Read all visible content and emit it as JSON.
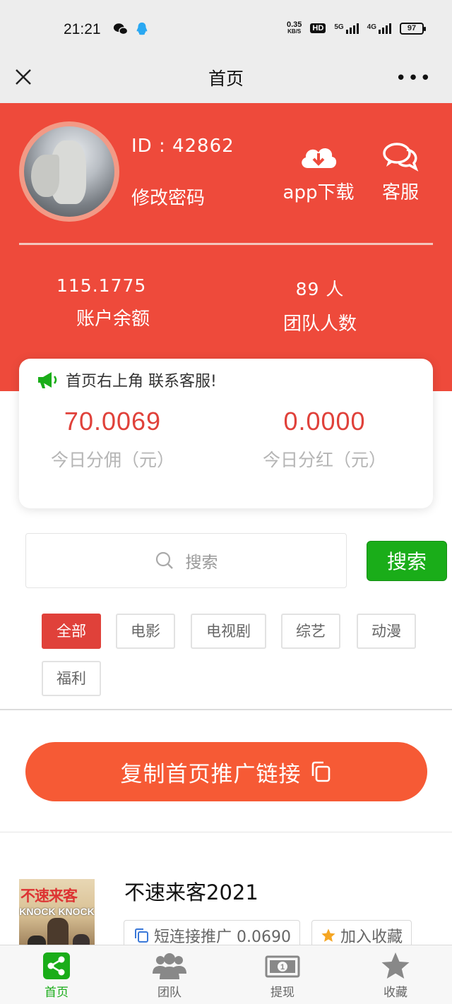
{
  "status_bar": {
    "time": "21:21",
    "net_speed_value": "0.35",
    "net_speed_unit": "KB/S",
    "hd_badge": "HD",
    "signal_1_label": "5G",
    "signal_2_label": "4G",
    "battery": "97",
    "app_icons": [
      "wechat-icon",
      "qq-icon"
    ]
  },
  "nav": {
    "title": "首页",
    "more": "•••"
  },
  "profile": {
    "id_text": "ID : 42862",
    "change_password": "修改密码",
    "app_download": "app下载",
    "customer_service": "客服"
  },
  "stats": {
    "balance_value": "115.1775",
    "balance_label": "账户余额",
    "team_value": "89 人",
    "team_label": "团队人数"
  },
  "card": {
    "notice": "首页右上角 联系客服!",
    "commission_value": "70.0069",
    "commission_label": "今日分佣（元）",
    "dividend_value": "0.0000",
    "dividend_label": "今日分红（元）"
  },
  "search": {
    "placeholder": "搜索",
    "button": "搜索"
  },
  "categories": [
    "全部",
    "电影",
    "电视剧",
    "综艺",
    "动漫",
    "福利"
  ],
  "active_category": "全部",
  "promo": {
    "label": "复制首页推广链接"
  },
  "movie": {
    "title": "不速来客2021",
    "poster_title": "不速来客",
    "poster_subtitle": "KNOCK KNOCK",
    "short_link_label": "短连接推广 0.0690",
    "favorite_label": "加入收藏"
  },
  "tabs": [
    {
      "label": "首页",
      "icon": "share-icon",
      "active": true
    },
    {
      "label": "团队",
      "icon": "team-icon",
      "active": false
    },
    {
      "label": "提现",
      "icon": "cash-icon",
      "active": false
    },
    {
      "label": "收藏",
      "icon": "star-icon",
      "active": false
    }
  ],
  "colors": {
    "brand_red": "#ee4a3b",
    "value_red": "#e0413a",
    "promo_orange": "#f65a35",
    "wechat_green": "#1aad19"
  }
}
